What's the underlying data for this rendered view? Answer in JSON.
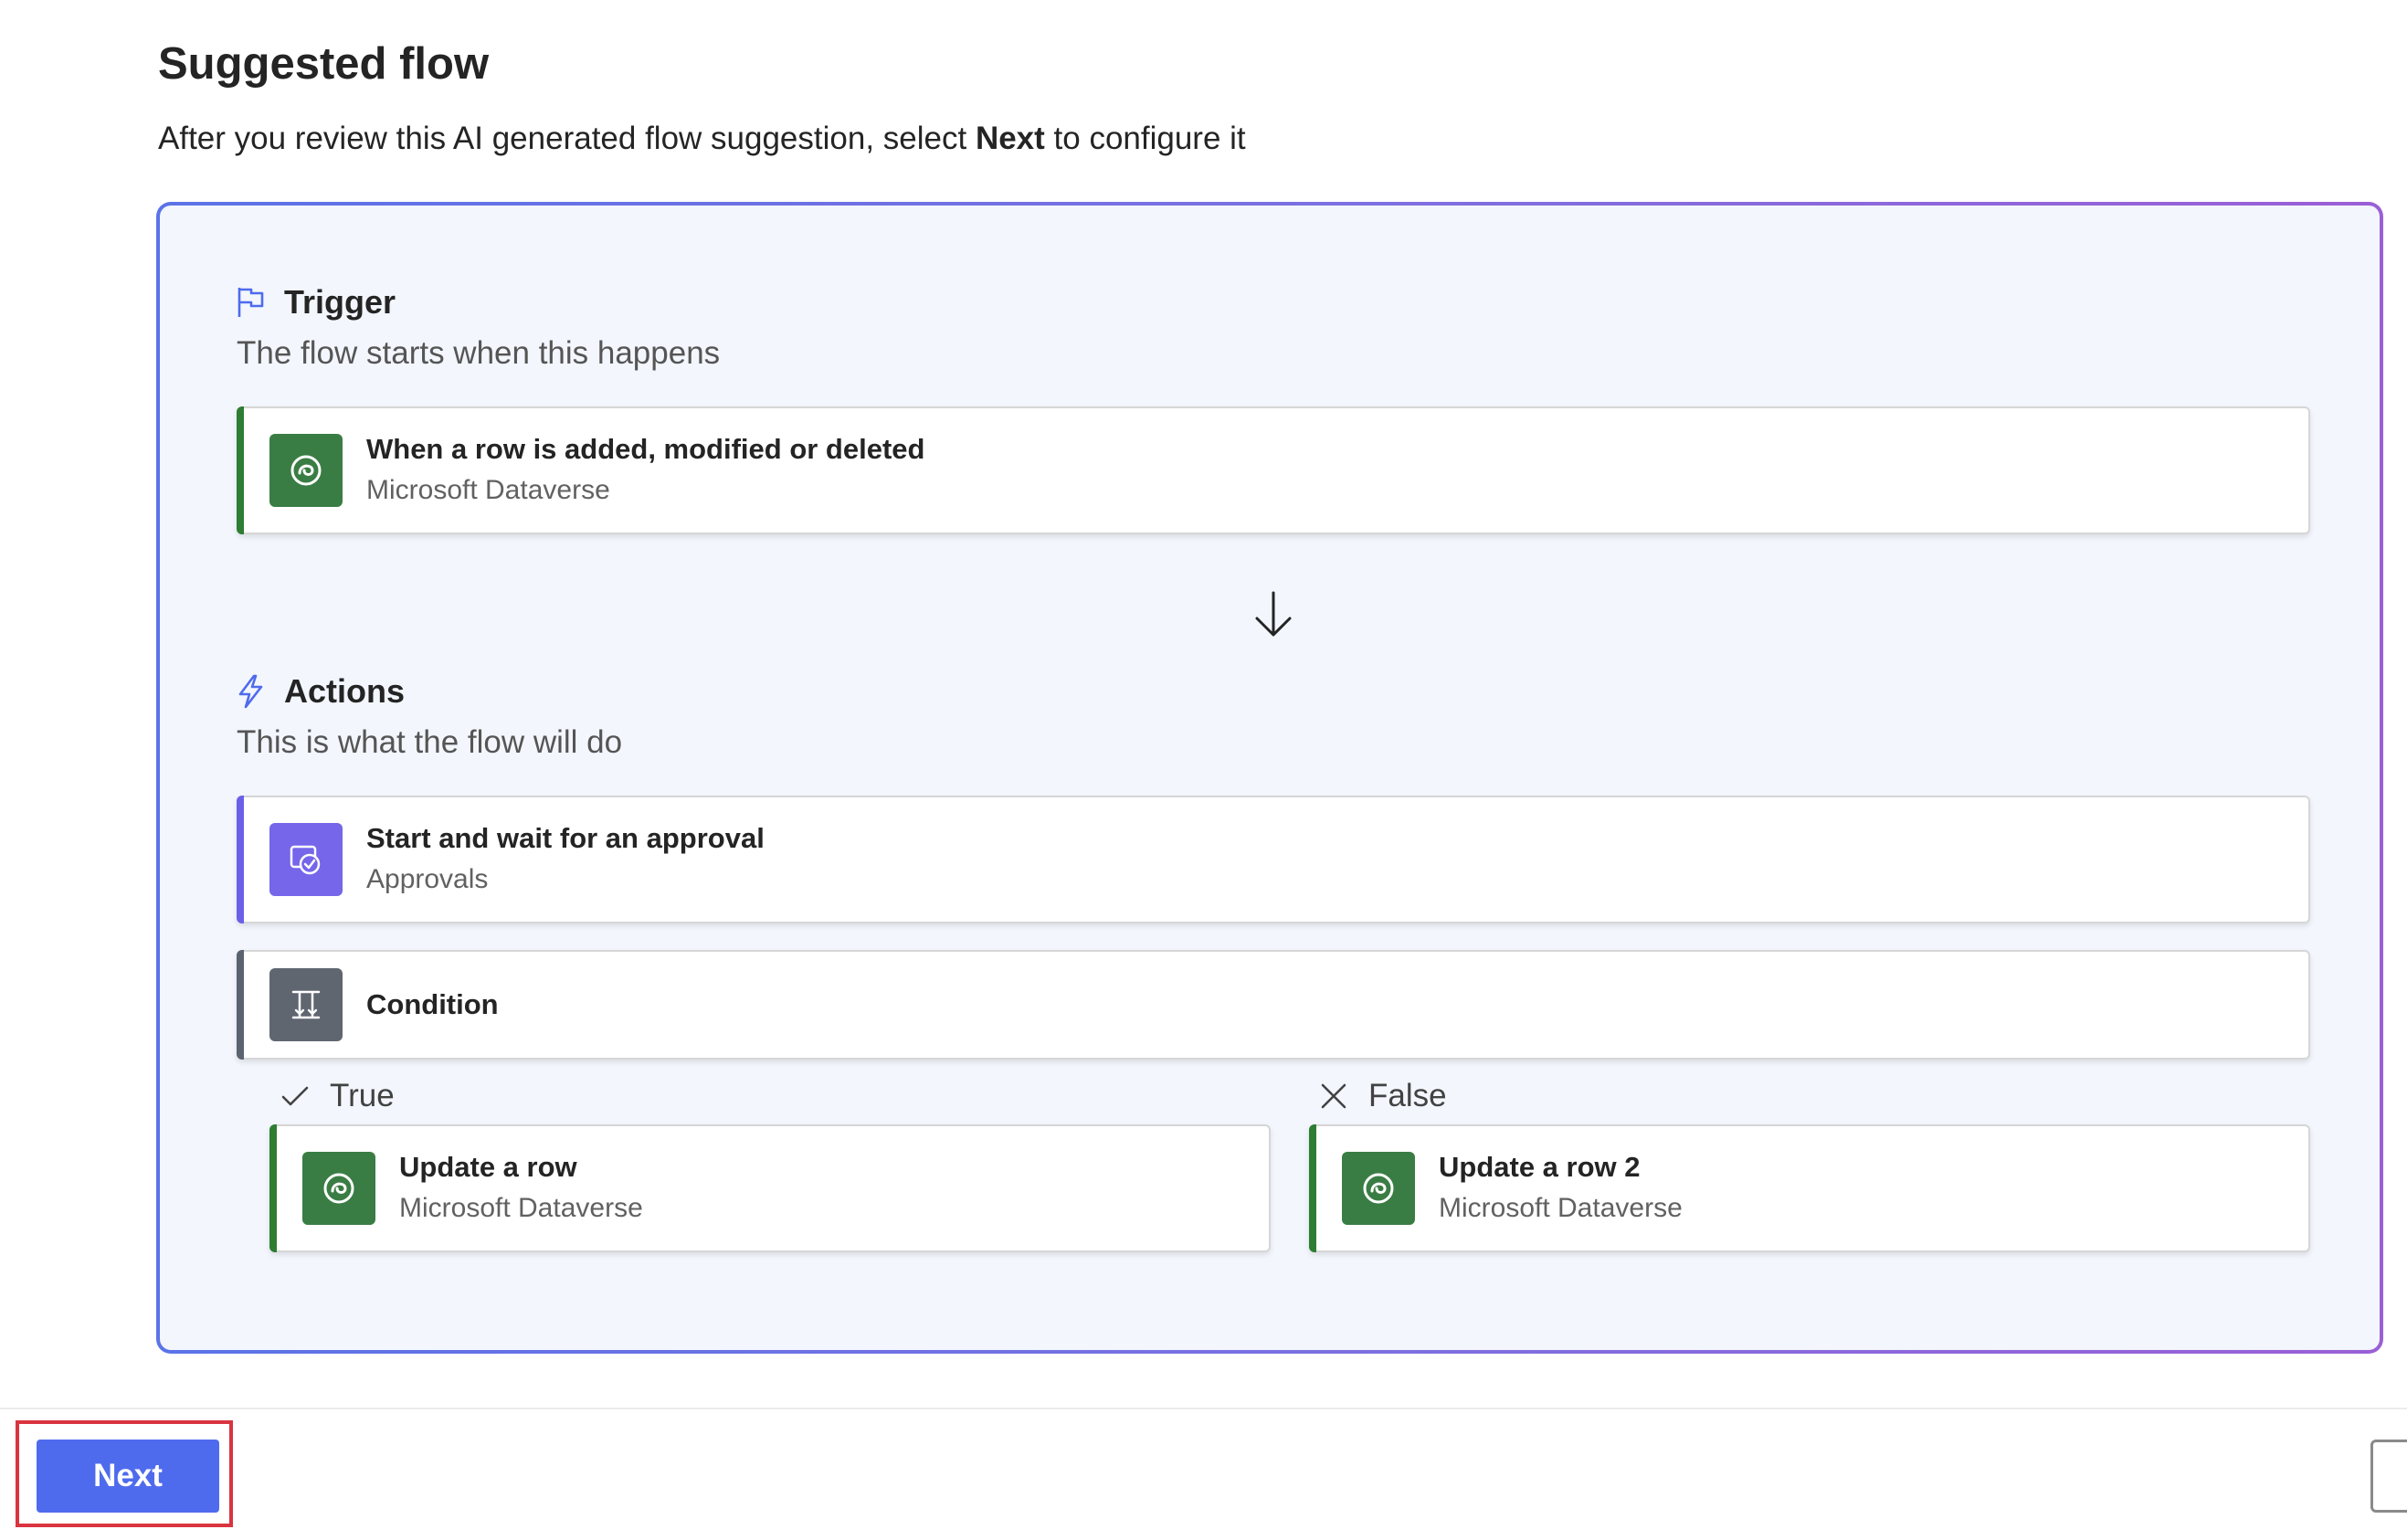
{
  "header": {
    "title": "Suggested flow",
    "subtitle_before": "After you review this AI generated flow suggestion, select ",
    "subtitle_bold": "Next",
    "subtitle_after": " to configure it"
  },
  "trigger": {
    "heading": "Trigger",
    "description": "The flow starts when this happens",
    "icon": "flag-icon",
    "card": {
      "title": "When a row is added, modified or deleted",
      "connector": "Microsoft Dataverse",
      "icon": "dataverse-icon",
      "accent": "#2e7d32"
    }
  },
  "arrow_icon": "arrow-down-icon",
  "actions": {
    "heading": "Actions",
    "description": "This is what the flow will do",
    "icon": "lightning-icon",
    "approval": {
      "title": "Start and wait for an approval",
      "connector": "Approvals",
      "icon": "approvals-icon",
      "accent": "#6b5fe8"
    },
    "condition": {
      "title": "Condition",
      "icon": "condition-icon",
      "accent": "#5c6370"
    },
    "true_branch": {
      "label": "True",
      "icon": "checkmark-icon",
      "card": {
        "title": "Update a row",
        "connector": "Microsoft Dataverse",
        "icon": "dataverse-icon"
      }
    },
    "false_branch": {
      "label": "False",
      "icon": "dismiss-icon",
      "card": {
        "title": "Update a row 2",
        "connector": "Microsoft Dataverse",
        "icon": "dataverse-icon"
      }
    }
  },
  "footer": {
    "next_label": "Next"
  },
  "colors": {
    "primary": "#4f6bed",
    "dataverse_green": "#3a7d44",
    "approvals_purple": "#7566ea",
    "condition_gray": "#5f6670",
    "highlight_red": "#d9343f"
  }
}
